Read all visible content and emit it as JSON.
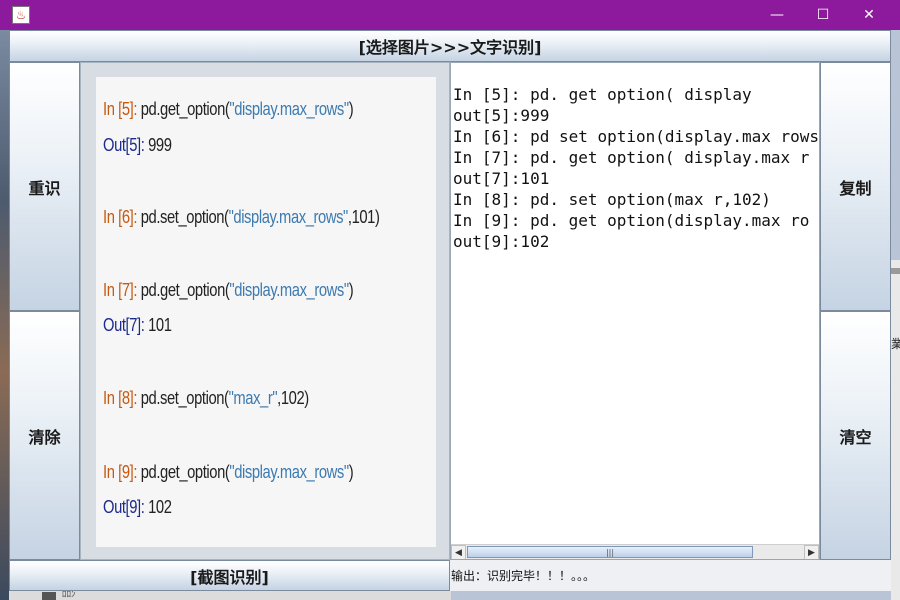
{
  "titlebar": {
    "app_icon_name": "java-coffee-icon",
    "minimize_glyph": "—",
    "maximize_glyph": "☐",
    "close_glyph": "✕"
  },
  "toolbar": {
    "select_image_label": "[选择图片>>>文字识别]",
    "crop_ocr_label": "[截图识别]"
  },
  "side_buttons": {
    "reidentify": "重识",
    "clear": "清除",
    "copy": "复制",
    "empty": "清空"
  },
  "image_preview": {
    "lines": [
      {
        "prompt": "In [5]:",
        "code": " pd.get_option(",
        "str": "\"display.max_rows\"",
        "tail": ")",
        "kind": "in"
      },
      {
        "prompt": "Out[5]:",
        "code": " 999",
        "str": "",
        "tail": "",
        "kind": "out"
      },
      {
        "prompt": "In [6]:",
        "code": " pd.set_option(",
        "str": "\"display.max_rows\"",
        "tail": ",101)",
        "kind": "in"
      },
      {
        "prompt": "In [7]:",
        "code": " pd.get_option(",
        "str": "\"display.max_rows\"",
        "tail": ")",
        "kind": "in"
      },
      {
        "prompt": "Out[7]:",
        "code": " 101",
        "str": "",
        "tail": "",
        "kind": "out"
      },
      {
        "prompt": "In [8]:",
        "code": " pd.set_option(",
        "str": "\"max_r\"",
        "tail": ",102)",
        "kind": "in"
      },
      {
        "prompt": "In [9]:",
        "code": " pd.get_option(",
        "str": "\"display.max_rows\"",
        "tail": ")",
        "kind": "in"
      },
      {
        "prompt": "Out[9]:",
        "code": " 102",
        "str": "",
        "tail": "",
        "kind": "out"
      }
    ]
  },
  "ocr_output": {
    "lines": [
      "In [5]: pd. get option( display",
      "out[5]:999",
      "In [6]: pd set option(display.max rows",
      "In [7]: pd. get option( display.max r",
      "out[7]:101",
      "In [8]: pd. set option(max r,102)",
      "In [9]: pd. get option(display.max ro",
      "out[9]:102"
    ]
  },
  "scrollbar": {
    "left_arrow": "◀",
    "right_arrow": "▶",
    "grip": "|||"
  },
  "status": {
    "text": "输出：识别完毕！！！。。。"
  },
  "desktop": {
    "right_edge_text": "業",
    "bottom_text": "ﾛﾛﾝ"
  }
}
